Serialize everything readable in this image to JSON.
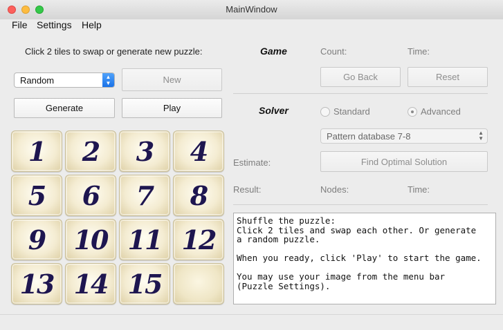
{
  "window": {
    "title": "MainWindow"
  },
  "menu": [
    "File",
    "Settings",
    "Help"
  ],
  "left": {
    "instruction": "Click 2 tiles to swap or generate new puzzle:",
    "mode_select": "Random",
    "new_label": "New",
    "generate_label": "Generate",
    "play_label": "Play"
  },
  "tiles": [
    "1",
    "2",
    "3",
    "4",
    "5",
    "6",
    "7",
    "8",
    "9",
    "10",
    "11",
    "12",
    "13",
    "14",
    "15",
    ""
  ],
  "game": {
    "heading": "Game",
    "count_label": "Count:",
    "time_label": "Time:",
    "go_back_label": "Go Back",
    "reset_label": "Reset"
  },
  "solver": {
    "heading": "Solver",
    "standard_label": "Standard",
    "advanced_label": "Advanced",
    "selected_mode": "Advanced",
    "database_select": "Pattern database 7-8",
    "estimate_label": "Estimate:",
    "find_label": "Find Optimal Solution",
    "result_label": "Result:",
    "nodes_label": "Nodes:",
    "time_label": "Time:"
  },
  "log": {
    "lines": [
      "Shuffle the puzzle:",
      "Click 2 tiles and swap each other. Or generate",
      "a random puzzle.",
      "",
      "When you ready, click 'Play' to start the game.",
      "",
      "You may use your image from the menu bar",
      "(Puzzle Settings)."
    ]
  },
  "colors": {
    "accent": "#1a72e8",
    "tile_number": "#1e1650",
    "tile_face": "#f4ecd2"
  }
}
